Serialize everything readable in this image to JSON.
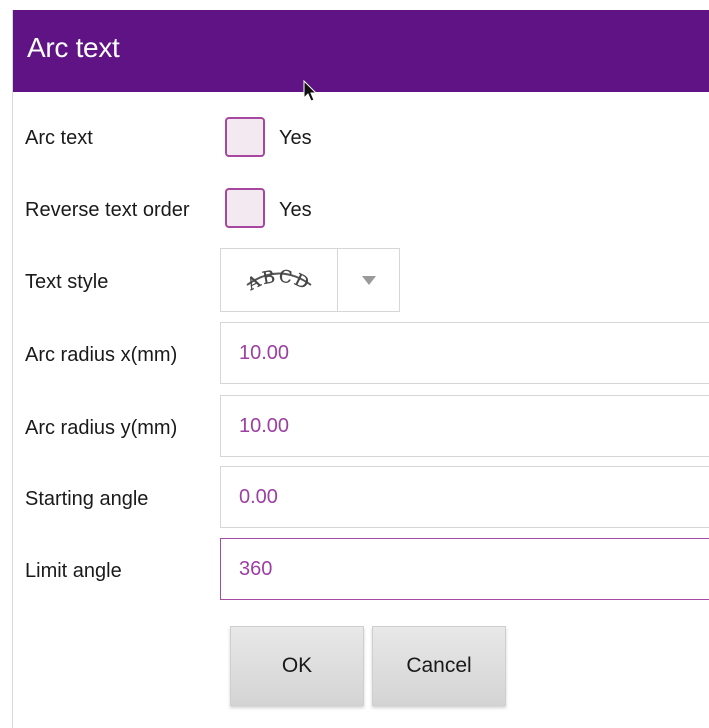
{
  "dialog": {
    "title": "Arc text",
    "title_bar_color": "#5f1385",
    "accent_color": "#a7479f"
  },
  "rows": {
    "arc_text": {
      "label": "Arc text",
      "checkbox_text": "Yes",
      "checked": false
    },
    "reverse_order": {
      "label": "Reverse text order",
      "checkbox_text": "Yes",
      "checked": false
    },
    "text_style": {
      "label": "Text style",
      "selected_preview": "ABCD",
      "preview_icon": "arc-text-style-icon"
    },
    "arc_radius_x": {
      "label": "Arc radius x(mm)",
      "value": "10.00"
    },
    "arc_radius_y": {
      "label": "Arc radius y(mm)",
      "value": "10.00"
    },
    "starting_angle": {
      "label": "Starting angle",
      "value": "0.00"
    },
    "limit_angle": {
      "label": "Limit angle",
      "value": "360"
    }
  },
  "buttons": {
    "ok": "OK",
    "cancel": "Cancel"
  }
}
